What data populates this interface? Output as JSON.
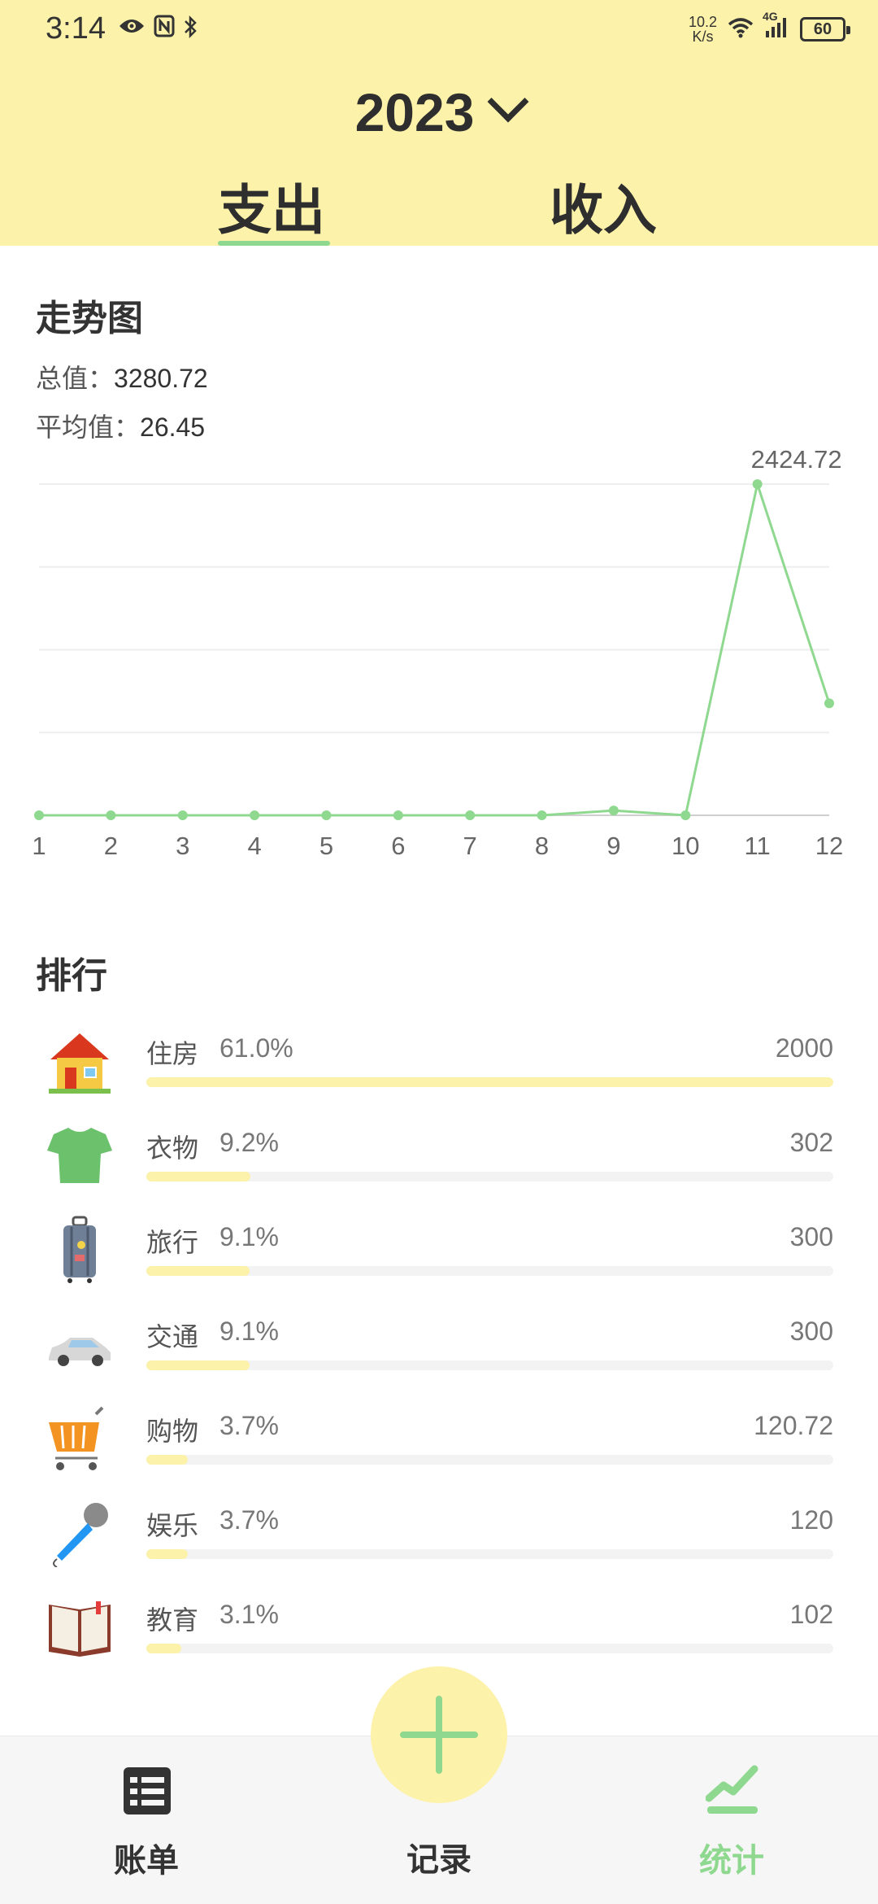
{
  "status_bar": {
    "time": "3:14",
    "net_speed_value": "10.2",
    "net_speed_unit": "K/s",
    "network": "4G",
    "battery": "60",
    "icons": [
      "eye-icon",
      "nfc-icon",
      "bluetooth-icon",
      "wifi-icon",
      "signal-icon",
      "battery-icon"
    ]
  },
  "header": {
    "year": "2023",
    "tabs": [
      {
        "label": "支出",
        "active": true
      },
      {
        "label": "收入",
        "active": false
      }
    ]
  },
  "trend": {
    "title": "走势图",
    "total_label": "总值：",
    "total_value": "3280.72",
    "avg_label": "平均值：",
    "avg_value": "26.45"
  },
  "chart_data": {
    "type": "line",
    "x": [
      1,
      2,
      3,
      4,
      5,
      6,
      7,
      8,
      9,
      10,
      11,
      12
    ],
    "series": [
      {
        "values": [
          0,
          0,
          0,
          0,
          0,
          0,
          0,
          0,
          35,
          0,
          2424.72,
          820
        ]
      }
    ],
    "peak_label": "2424.72",
    "ylim": [
      0,
      2424.72
    ],
    "grid": true,
    "color": "#8fd88f"
  },
  "ranking": {
    "title": "排行",
    "items": [
      {
        "name": "住房",
        "percent": "61.0%",
        "amount": "2000",
        "fraction": 1.0,
        "icon": "house-icon"
      },
      {
        "name": "衣物",
        "percent": "9.2%",
        "amount": "302",
        "fraction": 0.151,
        "icon": "tshirt-icon"
      },
      {
        "name": "旅行",
        "percent": "9.1%",
        "amount": "300",
        "fraction": 0.15,
        "icon": "luggage-icon"
      },
      {
        "name": "交通",
        "percent": "9.1%",
        "amount": "300",
        "fraction": 0.15,
        "icon": "car-icon"
      },
      {
        "name": "购物",
        "percent": "3.7%",
        "amount": "120.72",
        "fraction": 0.06,
        "icon": "shopping-cart-icon"
      },
      {
        "name": "娱乐",
        "percent": "3.7%",
        "amount": "120",
        "fraction": 0.06,
        "icon": "microphone-icon"
      },
      {
        "name": "教育",
        "percent": "3.1%",
        "amount": "102",
        "fraction": 0.051,
        "icon": "book-icon"
      }
    ]
  },
  "bottom_nav": {
    "bills_label": "账单",
    "record_label": "记录",
    "stats_label": "统计",
    "active": "统计",
    "active_color": "#8fd88f"
  },
  "colors": {
    "header_bg": "#fcf2a9",
    "accent": "#8fd88f",
    "bar_fill": "#fcf2a9"
  }
}
